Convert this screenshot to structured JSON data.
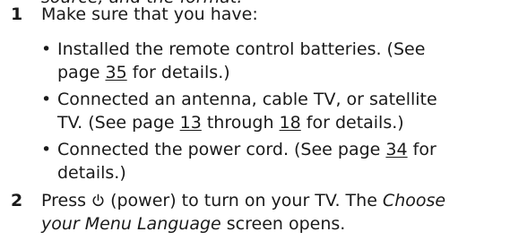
{
  "header_fragment": "source, and the format.",
  "steps": [
    {
      "number": "1",
      "text": "Make sure that you have:",
      "bullets": [
        {
          "lines": [
            {
              "before": "Installed the remote control batteries. (See"
            },
            {
              "before": "page ",
              "link": "35",
              "after": " for details.)"
            }
          ]
        },
        {
          "lines": [
            {
              "before": "Connected an antenna, cable TV, or satellite"
            },
            {
              "before": "TV. (See page ",
              "link": "13",
              "middle": " through ",
              "link2": "18",
              "after": " for details.)"
            }
          ]
        },
        {
          "lines": [
            {
              "before": "Connected the power cord. (See page ",
              "link": "34",
              "after": " for"
            },
            {
              "before": "details.)"
            }
          ]
        }
      ]
    },
    {
      "number": "2",
      "line1_before": "Press ",
      "icon": "power-icon",
      "line1_mid": " (power) to turn on your TV. The ",
      "line1_italic": "Choose",
      "line2_italic": "your Menu Language",
      "line2_after": " screen opens."
    }
  ],
  "bullet_glyph": "•"
}
